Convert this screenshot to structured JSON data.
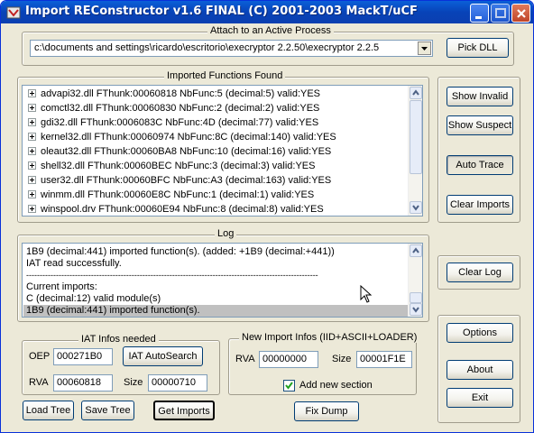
{
  "window": {
    "title": "Import REConstructor v1.6 FINAL (C) 2001-2003 MackT/uCF"
  },
  "attach": {
    "label": "Attach to an Active Process",
    "process_value": "c:\\documents and settings\\ricardo\\escritorio\\execryptor 2.2.50\\execryptor 2.2.5",
    "pick_dll": "Pick DLL"
  },
  "imports": {
    "label": "Imported Functions Found",
    "items": [
      "advapi32.dll FThunk:00060818 NbFunc:5 (decimal:5) valid:YES",
      "comctl32.dll FThunk:00060830 NbFunc:2 (decimal:2) valid:YES",
      "gdi32.dll FThunk:0006083C NbFunc:4D (decimal:77) valid:YES",
      "kernel32.dll FThunk:00060974 NbFunc:8C (decimal:140) valid:YES",
      "oleaut32.dll FThunk:00060BA8 NbFunc:10 (decimal:16) valid:YES",
      "shell32.dll FThunk:00060BEC NbFunc:3 (decimal:3) valid:YES",
      "user32.dll FThunk:00060BFC NbFunc:A3 (decimal:163) valid:YES",
      "winmm.dll FThunk:00060E8C NbFunc:1 (decimal:1) valid:YES",
      "winspool.drv FThunk:00060E94 NbFunc:8 (decimal:8) valid:YES"
    ]
  },
  "side_buttons": {
    "show_invalid": "Show Invalid",
    "show_suspect": "Show Suspect",
    "auto_trace": "Auto Trace",
    "clear_imports": "Clear Imports",
    "clear_log": "Clear Log",
    "options": "Options",
    "about": "About",
    "exit": "Exit"
  },
  "log": {
    "label": "Log",
    "lines": [
      "1B9 (decimal:441) imported function(s). (added: +1B9 (decimal:+441))",
      "IAT read successfully.",
      "------------------------------------------------------------------------------------------------------------",
      "Current imports:",
      "C (decimal:12) valid module(s)",
      "1B9 (decimal:441) imported function(s)."
    ]
  },
  "iat": {
    "label": "IAT Infos needed",
    "oep_label": "OEP",
    "oep_value": "000271B0",
    "autosearch": "IAT AutoSearch",
    "rva_label": "RVA",
    "rva_value": "00060818",
    "size_label": "Size",
    "size_value": "00000710"
  },
  "new_import": {
    "label": "New Import Infos (IID+ASCII+LOADER)",
    "rva_label": "RVA",
    "rva_value": "00000000",
    "size_label": "Size",
    "size_value": "00001F1E",
    "add_section_label": "Add new section",
    "add_section_checked": true
  },
  "bottom_buttons": {
    "load_tree": "Load Tree",
    "save_tree": "Save Tree",
    "get_imports": "Get Imports",
    "fix_dump": "Fix Dump"
  }
}
